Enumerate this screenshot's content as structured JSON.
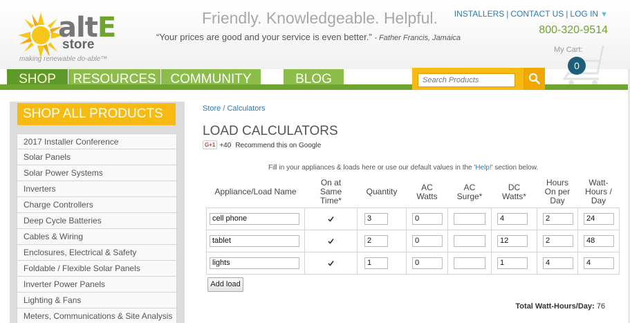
{
  "header": {
    "logo": {
      "word_alt": "alt",
      "word_e": "E",
      "store": "store",
      "tagline": "making renewable do-able™"
    },
    "tagline": "Friendly. Knowledgeable. Helpful.",
    "quote": "“Your prices are good and your service is even better.”",
    "quote_author": "- Father Francis, Jamaica",
    "links": [
      "INSTALLERS",
      "CONTACT US",
      "LOG IN"
    ],
    "phone": "800-320-9514",
    "cart_label": "My Cart:",
    "cart_count": "0"
  },
  "nav": {
    "tabs": [
      "SHOP",
      "RESOURCES",
      "COMMUNITY",
      "BLOG"
    ],
    "active": "SHOP",
    "search_placeholder": "Search Products"
  },
  "sidebar": {
    "heading": "SHOP ALL PRODUCTS",
    "items": [
      "2017 Installer Conference",
      "Solar Panels",
      "Solar Power Systems",
      "Inverters",
      "Charge Controllers",
      "Deep Cycle Batteries",
      "Cables & Wiring",
      "Enclosures, Electrical & Safety",
      "Foldable / Flexible Solar Panels",
      "Inverter Power Panels",
      "Lighting & Fans",
      "Meters, Communications & Site Analysis"
    ]
  },
  "main": {
    "breadcrumb": "Store / Calculators",
    "title": "LOAD CALCULATORS",
    "gplus_button": "G+1",
    "gplus_count": "+40",
    "gplus_text": "Recommend this on Google",
    "intro_before": "Fill in your appliances & loads here or use our default values in the '",
    "intro_help": "Help!",
    "intro_after": "' section below.",
    "columns": [
      "Appliance/Load Name",
      "On at Same Time*",
      "Quantity",
      "AC Watts",
      "AC Surge*",
      "DC Watts*",
      "Hours On per Day",
      "Watt-Hours / Day"
    ],
    "rows": [
      {
        "name": "cell phone",
        "same_time": true,
        "quantity": "3",
        "ac_watts": "0",
        "ac_surge": "",
        "dc_watts": "4",
        "hours": "2",
        "watt_hours": "24"
      },
      {
        "name": "tablet",
        "same_time": true,
        "quantity": "2",
        "ac_watts": "0",
        "ac_surge": "",
        "dc_watts": "12",
        "hours": "2",
        "watt_hours": "48"
      },
      {
        "name": "lights",
        "same_time": true,
        "quantity": "1",
        "ac_watts": "0",
        "ac_surge": "",
        "dc_watts": "1",
        "hours": "4",
        "watt_hours": "4"
      }
    ],
    "add_load_label": "Add load",
    "total_label": "Total Watt-Hours/Day:",
    "total_value": "76"
  },
  "colors": {
    "brand_green": "#6ea52f",
    "nav_green": "#8cbc4a",
    "accent_yellow": "#f6ba12",
    "link_blue": "#2b7bb9",
    "cart_badge": "#1d5e79"
  }
}
